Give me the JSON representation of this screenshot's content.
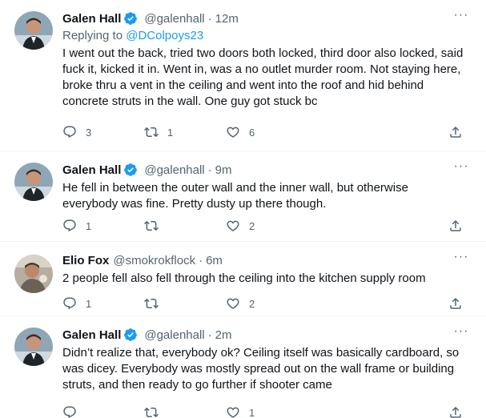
{
  "tweets": [
    {
      "name": "Galen Hall",
      "verified": true,
      "handle": "@galenhall",
      "separator": "·",
      "time": "12m",
      "replying_prefix": "Replying to ",
      "replying_to": "@DColpoys23",
      "text": "I went out the back, tried two doors both locked, third door also locked, said fuck it, kicked it in. Went in, was a no outlet murder room. Not staying here, broke thru a vent in the ceiling and went into the roof and hid behind concrete struts in the wall. One guy got stuck bc",
      "reply_count": "3",
      "retweet_count": "1",
      "like_count": "6",
      "more": "···"
    },
    {
      "name": "Galen Hall",
      "verified": true,
      "handle": "@galenhall",
      "separator": "·",
      "time": "9m",
      "text": "He fell in between the outer wall and the inner wall, but otherwise everybody was fine. Pretty dusty up there though.",
      "reply_count": "1",
      "retweet_count": "",
      "like_count": "2",
      "more": "···"
    },
    {
      "name": "Elio Fox",
      "verified": false,
      "handle": "@smokrokflock",
      "separator": "·",
      "time": "6m",
      "text": "2 people fell also fell through the ceiling into the kitchen supply room",
      "reply_count": "1",
      "retweet_count": "",
      "like_count": "2",
      "more": "···"
    },
    {
      "name": "Galen Hall",
      "verified": true,
      "handle": "@galenhall",
      "separator": "·",
      "time": "2m",
      "text": "Didn’t realize that, everybody ok? Ceiling itself was basically cardboard, so was dicey. Everybody was mostly spread out on the wall frame or building struts, and then ready to go further if shooter came",
      "reply_count": "",
      "retweet_count": "",
      "like_count": "1",
      "more": "···"
    }
  ],
  "icons": {
    "reply": "reply-icon",
    "retweet": "retweet-icon",
    "like": "like-icon",
    "share": "share-icon",
    "verified": "verified-badge-icon",
    "more": "more-options-icon"
  },
  "colors": {
    "text": "#0f1419",
    "secondary": "#536471",
    "accent": "#1d9bf0",
    "divider": "#eff3f4"
  }
}
